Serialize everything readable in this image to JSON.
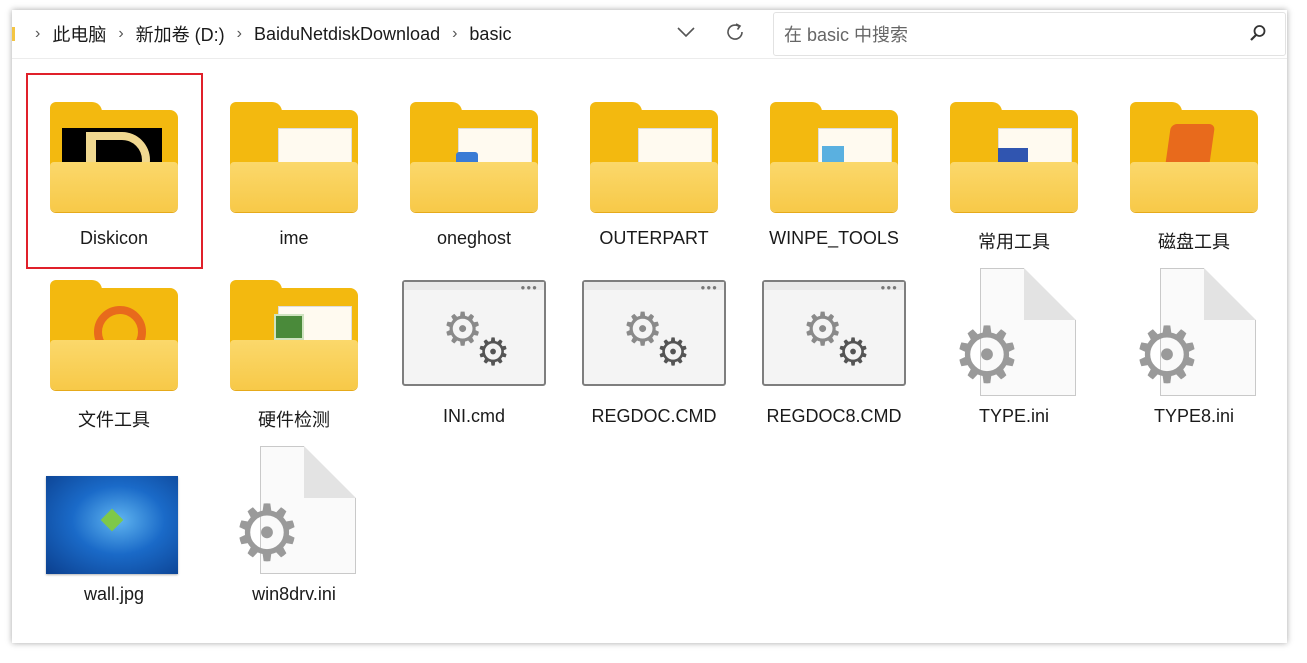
{
  "breadcrumb": [
    "此电脑",
    "新加卷 (D:)",
    "BaiduNetdiskDownload",
    "basic"
  ],
  "search": {
    "placeholder": "在 basic 中搜索"
  },
  "icons": {
    "dropdown": "chevron-down-icon",
    "refresh": "refresh-icon",
    "search": "search-icon"
  },
  "items": [
    {
      "name": "Diskicon",
      "type": "folder",
      "selected": true
    },
    {
      "name": "ime",
      "type": "folder"
    },
    {
      "name": "oneghost",
      "type": "folder"
    },
    {
      "name": "OUTERPART",
      "type": "folder"
    },
    {
      "name": "WINPE_TOOLS",
      "type": "folder"
    },
    {
      "name": "常用工具",
      "type": "folder"
    },
    {
      "name": "磁盘工具",
      "type": "folder"
    },
    {
      "name": "文件工具",
      "type": "folder"
    },
    {
      "name": "硬件检测",
      "type": "folder"
    },
    {
      "name": "INI.cmd",
      "type": "cmd"
    },
    {
      "name": "REGDOC.CMD",
      "type": "cmd"
    },
    {
      "name": "REGDOC8.CMD",
      "type": "cmd"
    },
    {
      "name": "TYPE.ini",
      "type": "ini"
    },
    {
      "name": "TYPE8.ini",
      "type": "ini"
    },
    {
      "name": "wall.jpg",
      "type": "image"
    },
    {
      "name": "win8drv.ini",
      "type": "ini"
    }
  ],
  "colors": {
    "folder": "#f3b90f",
    "selection": "#e0202a"
  }
}
